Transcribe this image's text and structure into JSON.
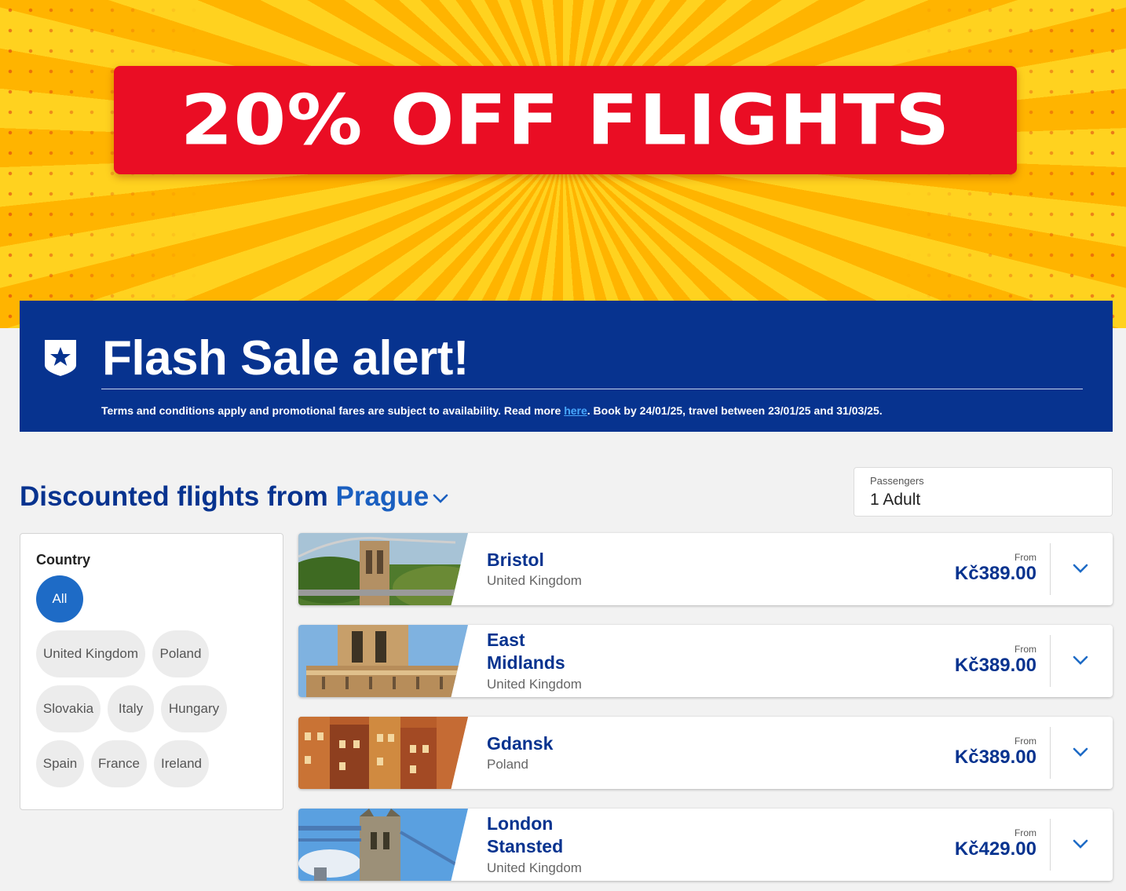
{
  "hero": {
    "banner_text": "20% OFF FLIGHTS"
  },
  "flash_sale": {
    "title": "Flash Sale alert!",
    "terms_prefix": "Terms and conditions apply and promotional fares are subject to availability. Read more ",
    "terms_link": "here",
    "terms_suffix": ". Book by 24/01/25, travel between 23/01/25 and 31/03/25.",
    "icon": "star-shield-icon"
  },
  "heading": {
    "prefix": "Discounted flights from ",
    "city": "Prague"
  },
  "passengers": {
    "label": "Passengers",
    "value": "1 Adult"
  },
  "filter": {
    "title": "Country",
    "chips": [
      "All",
      "United Kingdom",
      "Poland",
      "Slovakia",
      "Italy",
      "Hungary",
      "Spain",
      "France",
      "Ireland"
    ],
    "selected": "All"
  },
  "flights": [
    {
      "name_lines": [
        "Bristol"
      ],
      "country": "United Kingdom",
      "from_label": "From",
      "price": "Kč389.00",
      "image": "suspension-bridge"
    },
    {
      "name_lines": [
        "East",
        "Midlands"
      ],
      "country": "United Kingdom",
      "from_label": "From",
      "price": "Kč389.00",
      "image": "stone-building"
    },
    {
      "name_lines": [
        "Gdansk"
      ],
      "country": "Poland",
      "from_label": "From",
      "price": "Kč389.00",
      "image": "old-town-houses"
    },
    {
      "name_lines": [
        "London",
        "Stansted"
      ],
      "country": "United Kingdom",
      "from_label": "From",
      "price": "Kč429.00",
      "image": "tower-bridge"
    }
  ],
  "colors": {
    "brand_blue": "#07338f",
    "accent_blue": "#1e6bc6",
    "banner_red": "#ea0d24",
    "banner_yellow": "#ffd21f"
  }
}
